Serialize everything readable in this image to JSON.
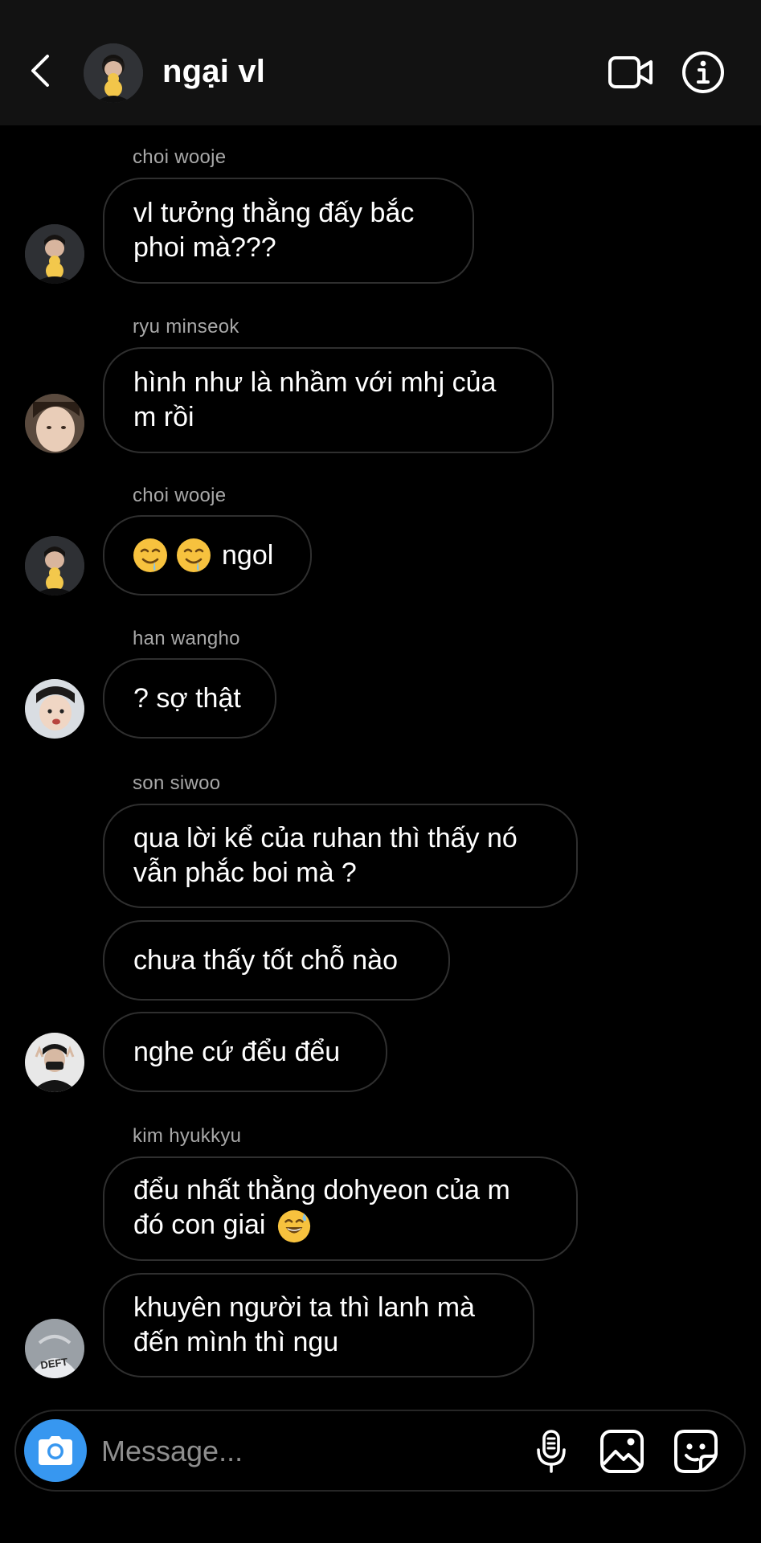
{
  "header": {
    "title": "ngại vl",
    "back_icon": "chevron-left-icon",
    "video_icon": "video-call-icon",
    "info_icon": "info-icon"
  },
  "messages": [
    {
      "sender": "choi wooje",
      "text": "vl tưởng thằng đấy bắc\nphoi mà???"
    },
    {
      "sender": "ryu minseok",
      "text": "hình như là nhầm với mhj của\nm rồi"
    },
    {
      "sender": "choi wooje",
      "text": "ngol",
      "emoji": "drooling-face-icon"
    },
    {
      "sender": "han wangho",
      "text": "? sợ thật"
    },
    {
      "sender": "son siwoo",
      "text": "qua lời kể của ruhan thì thấy nó\nvẫn phắc boi mà ?"
    },
    {
      "sender": "",
      "text": "chưa thấy tốt chỗ nào"
    },
    {
      "sender": "",
      "text": "nghe cứ đểu đểu"
    },
    {
      "sender": "kim hyukkyu",
      "text": "đểu nhất thằng dohyeon của m\nđó con giai",
      "emoji": "grinning-sweat-face-icon"
    },
    {
      "sender": "",
      "text": "khuyên người ta thì lanh mà\nđến mình thì ngu"
    }
  ],
  "avatar_texts": {
    "kim_hyukkyu": "DEFT"
  },
  "composer": {
    "placeholder": "Message...",
    "camera_icon": "camera-icon",
    "mic_icon": "microphone-icon",
    "gallery_icon": "gallery-icon",
    "sticker_icon": "sticker-icon"
  },
  "colors": {
    "background": "#000000",
    "header": "#121212",
    "bubble_border": "#2f2f2f",
    "sender_name": "#a8a8a8",
    "camera_button": "#3797f0",
    "placeholder": "#8e8e8e"
  }
}
